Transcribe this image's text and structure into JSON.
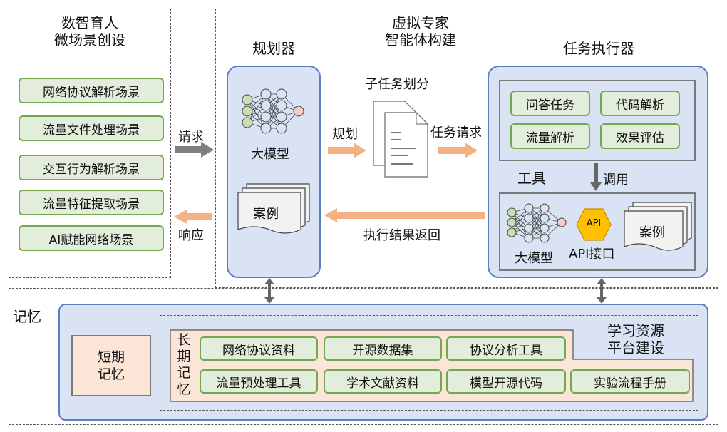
{
  "left_panel": {
    "title_line1": "数智育人",
    "title_line2": "微场景创设",
    "scenes": [
      "网络协议解析场景",
      "流量文件处理场景",
      "交互行为解析场景",
      "流量特征提取场景",
      "AI赋能网络场景"
    ]
  },
  "request_label": "请求",
  "response_label": "响应",
  "center_title_line1": "虚拟专家",
  "center_title_line2": "智能体构建",
  "planner": {
    "title": "规划器",
    "model_label": "大模型",
    "case_label": "案例"
  },
  "subtask_label": "子任务划分",
  "plan_label": "规划",
  "task_request_label": "任务请求",
  "result_return_label": "执行结果返回",
  "executor": {
    "title": "任务执行器",
    "tasks": [
      "问答任务",
      "代码解析",
      "流量解析",
      "效果评估"
    ],
    "tools_label": "工具",
    "invoke_label": "调用",
    "model_label": "大模型",
    "api_icon_text": "API",
    "api_label": "API接口",
    "case_label": "案例"
  },
  "memory": {
    "title": "记忆",
    "short_term": "短期\n记忆",
    "long_term_chars": [
      "长",
      "期",
      "记",
      "忆"
    ],
    "platform_line1": "学习资源",
    "platform_line2": "平台建设",
    "row1": [
      "网络协议资料",
      "开源数据集",
      "协议分析工具"
    ],
    "row2": [
      "流量预处理工具",
      "学术文献资料",
      "模型开源代码",
      "实验流程手册"
    ]
  },
  "colors": {
    "green_fill": "#e2eedb",
    "green_border": "#72a94e",
    "blue_fill": "#dae3f3",
    "blue_border": "#5b7ec0",
    "orange_arrow": "#f4b183",
    "peach_fill": "#fbe5d6",
    "api_hex": "#ffc000"
  }
}
